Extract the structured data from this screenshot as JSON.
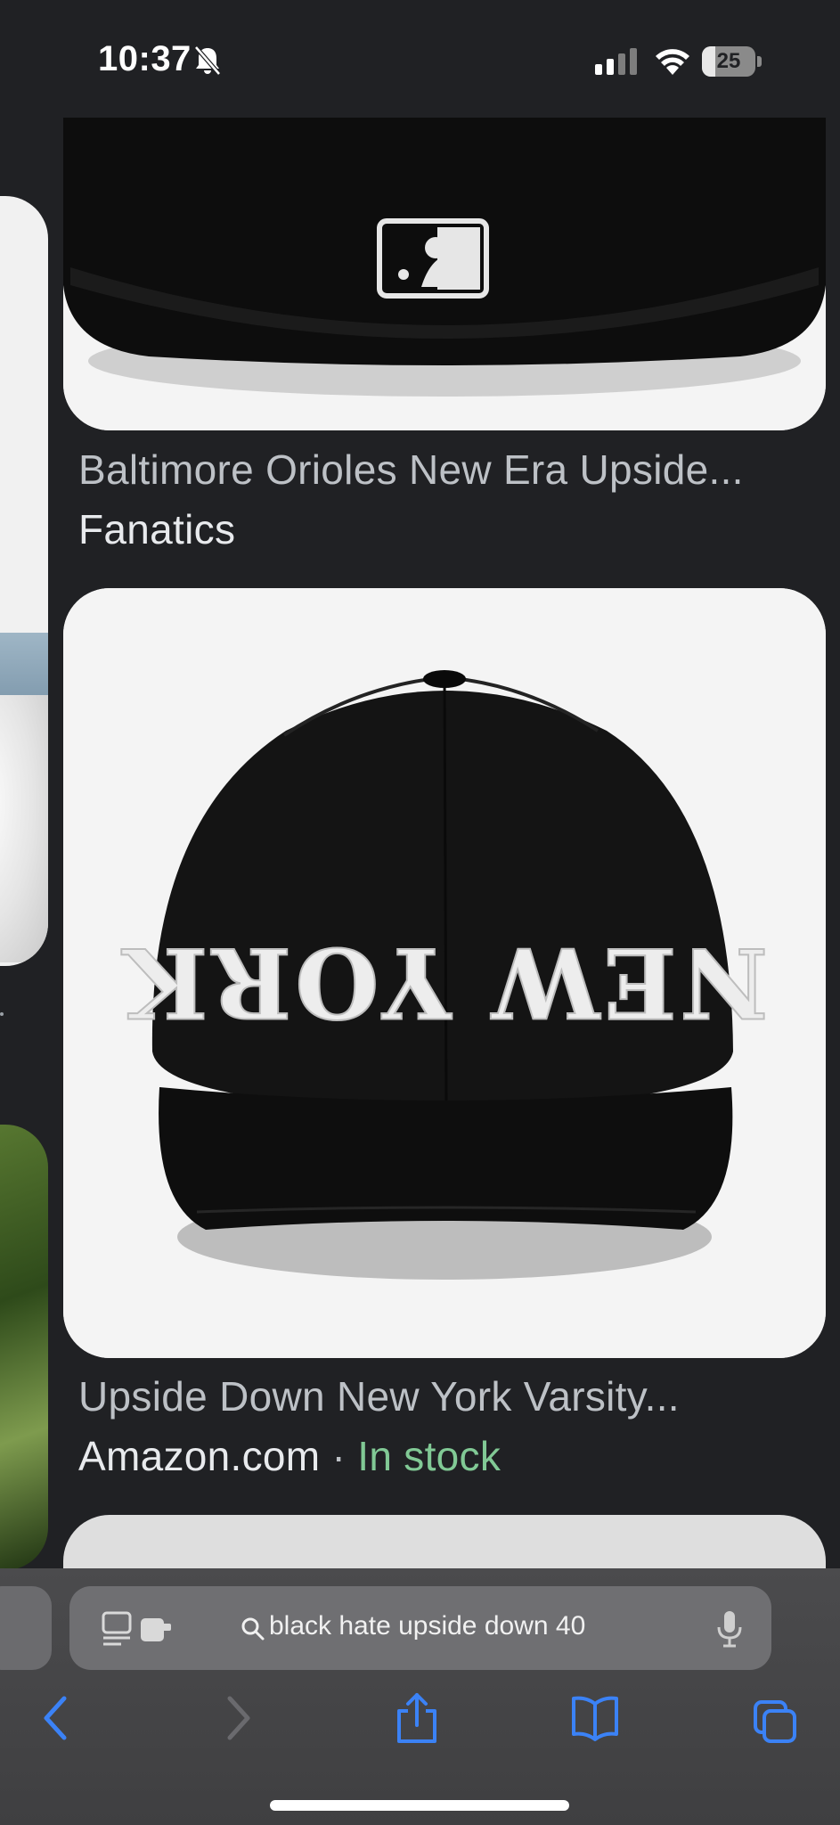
{
  "status_bar": {
    "time": "10:37",
    "battery_level": "25",
    "silent_mode": true,
    "icons": [
      "bell-slash-icon",
      "cellular-signal-icon",
      "wifi-icon",
      "battery-icon"
    ]
  },
  "results": [
    {
      "title": "Baltimore Orioles New Era Upside...",
      "source": "Fanatics",
      "image": "black cap back with MLB logo"
    },
    {
      "title": "Upside Down New York Varsity...",
      "source": "Amazon.com",
      "separator": "·",
      "availability": "In stock",
      "image": "black cap with upside-down NEW YORK lettering"
    }
  ],
  "address_bar": {
    "query": "black hate upside down 40",
    "icons": [
      "reader-mode-icon",
      "search-icon",
      "microphone-icon"
    ]
  },
  "toolbar": {
    "icons": [
      "back-chevron-icon",
      "forward-chevron-icon",
      "share-icon",
      "bookmarks-icon",
      "tabs-icon"
    ]
  },
  "colors": {
    "background": "#202124",
    "title_text": "#bdc1c6",
    "source_text": "#e8eaed",
    "in_stock": "#81c995",
    "toolbar_accent": "#3b82f6"
  }
}
